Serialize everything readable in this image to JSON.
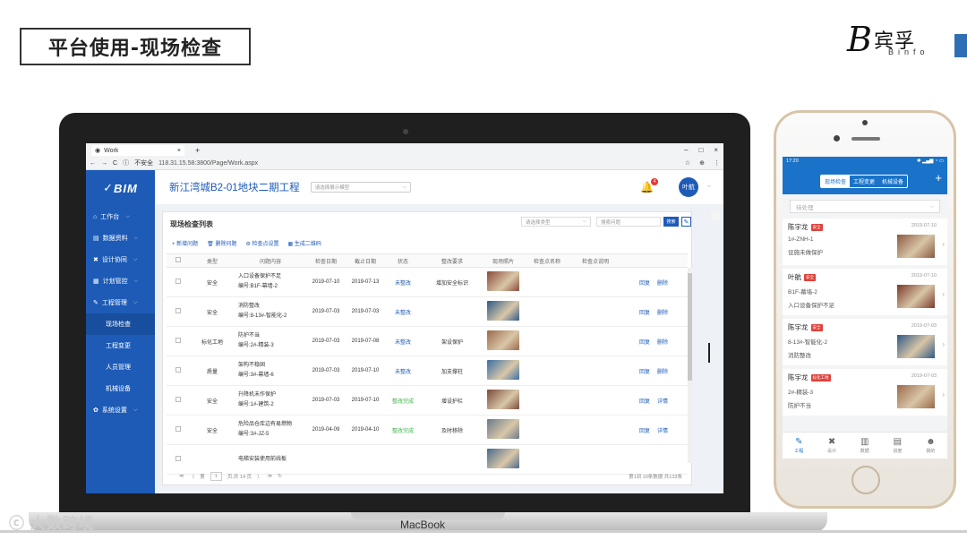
{
  "slide_title": "平台使用-现场检查",
  "logo": {
    "cn": "宾孚",
    "en": "Binfo"
  },
  "laptop_brand": "MacBook",
  "watermark": "大数跨境",
  "browser": {
    "tab_title": "Work",
    "tab_close": "×",
    "new_tab": "+",
    "window_controls": [
      "–",
      "□",
      "×"
    ],
    "nav": [
      "←",
      "→",
      "C",
      "ⓘ"
    ],
    "security": "不安全",
    "url": "118.31.15.58:3800/Page/Work.aspx",
    "icons": [
      "☆",
      "⊕",
      "⋮"
    ]
  },
  "app": {
    "brand": "BIM",
    "sidebar": [
      {
        "label": "工作台",
        "icon": "⌂",
        "chev": "⌵"
      },
      {
        "label": "数据资料",
        "icon": "▤",
        "chev": "⌵"
      },
      {
        "label": "设计协同",
        "icon": "✖",
        "chev": "⌵"
      },
      {
        "label": "计划管控",
        "icon": "▦",
        "chev": "⌵"
      },
      {
        "label": "工程管理",
        "icon": "✎",
        "chev": "⌵"
      }
    ],
    "subnav": [
      "现场检查",
      "工程变更",
      "人员管理",
      "机械设备"
    ],
    "sidebar_last": {
      "label": "系统设置",
      "icon": "✿",
      "chev": "⌵"
    },
    "project": "新江湾城B2-01地块二期工程",
    "model_select": "请选择展示模型",
    "notification_count": "4",
    "user": "叶航",
    "panel": {
      "title": "现场检查列表",
      "filter_placeholder": "请选择类型",
      "search_placeholder": "搜索问题",
      "search_btn": "搜索",
      "toolbar": [
        "+ 新增问题",
        "🗑 删除问题",
        "⚙ 检查点设置",
        "▦ 生成二维码"
      ],
      "columns": [
        "",
        "类型",
        "问题内容",
        "检查日期",
        "截止日期",
        "状态",
        "整改要求",
        "现场照片",
        "检查点名称",
        "检查点说明",
        ""
      ],
      "rows": [
        {
          "type": "安全",
          "title": "入口设备保护不足",
          "code": "编号:B1F-幕墙-2",
          "check": "2019-07-10",
          "due": "2019-07-13",
          "status": "未整改",
          "req": "增加安全标识",
          "status_color": "blue",
          "photo": "#8a4a3a"
        },
        {
          "type": "安全",
          "title": "消防整改",
          "code": "编号:8-13#-智能化-2",
          "check": "2019-07-03",
          "due": "2019-07-03",
          "status": "未整改",
          "req": "",
          "status_color": "blue",
          "photo": "#2f5a86"
        },
        {
          "type": "标化工地",
          "title": "防护不当",
          "code": "编号:2#-精装-3",
          "check": "2019-07-03",
          "due": "2019-07-08",
          "status": "未整改",
          "req": "架设保护",
          "status_color": "blue",
          "photo": "#9a6a4a"
        },
        {
          "type": "质量",
          "title": "架构不稳固",
          "code": "编号:3#-幕墙-6",
          "check": "2019-07-03",
          "due": "2019-07-10",
          "status": "未整改",
          "req": "加支撑柱",
          "status_color": "blue",
          "photo": "#3a6fa5"
        },
        {
          "type": "安全",
          "title": "升降机未作保护",
          "code": "编号:1#-建筑-2",
          "check": "2019-07-03",
          "due": "2019-07-10",
          "status": "整改完成",
          "req": "增设护栏",
          "status_color": "green",
          "photo": "#7a4a3a"
        },
        {
          "type": "安全",
          "title": "危险品仓库边有易燃物",
          "code": "编号:3#-JZ-5",
          "check": "2019-04-09",
          "due": "2019-04-10",
          "status": "整改完成",
          "req": "及时移除",
          "status_color": "green",
          "photo": "#6a7a8a"
        },
        {
          "type": "",
          "title": "电梯安装使用前线板",
          "code": "",
          "check": "",
          "due": "",
          "status": "",
          "req": "",
          "status_color": "blue",
          "photo": "#4a6a8a"
        }
      ],
      "row_actions": [
        "回复",
        "删除"
      ],
      "row_actions_alt": [
        "回复",
        "详情"
      ],
      "pager": {
        "prev_first": "≪",
        "prev": "〈",
        "page_prefix": "第",
        "page": "1",
        "page_suffix": "页,共 14 页",
        "next": "〉",
        "next_last": "≫",
        "refresh": "↻",
        "info": "第1到 10条数据 共133条"
      }
    }
  },
  "phone": {
    "time": "17:20",
    "signal": "✱ ▂▄▆ ◔ ▭",
    "tabs": [
      "现场检查",
      "工程变更",
      "机械设备"
    ],
    "plus": "+",
    "filter": "待处理",
    "filter_chev": "⌵",
    "cards": [
      {
        "name": "陈宇龙",
        "tag": "安全",
        "tag_color": "#e0413a",
        "date": "2019-07-10",
        "l2": "1#-ZNH-1",
        "l3": "设施未做保护",
        "photo": "#8b5a42"
      },
      {
        "name": "叶航",
        "tag": "安全",
        "tag_color": "#e0413a",
        "date": "2019-07-10",
        "l2": "B1F-幕墙-2",
        "l3": "入口设备保护不足",
        "photo": "#7a3a2a"
      },
      {
        "name": "陈宇龙",
        "tag": "安全",
        "tag_color": "#e0413a",
        "date": "2019-07-03",
        "l2": "8-13#-智能化-2",
        "l3": "消防整改",
        "photo": "#2f5a86"
      },
      {
        "name": "陈宇龙",
        "tag": "标化工地",
        "tag_color": "#e0413a",
        "date": "2019-07-03",
        "l2": "2#-精装-3",
        "l3": "防护不当",
        "photo": "#9a6a4a"
      }
    ],
    "tabbar": [
      {
        "label": "工程",
        "icon": "✎"
      },
      {
        "label": "设计",
        "icon": "✖"
      },
      {
        "label": "数据",
        "icon": "▥"
      },
      {
        "label": "进度",
        "icon": "▤"
      },
      {
        "label": "我的",
        "icon": "☻"
      }
    ]
  }
}
